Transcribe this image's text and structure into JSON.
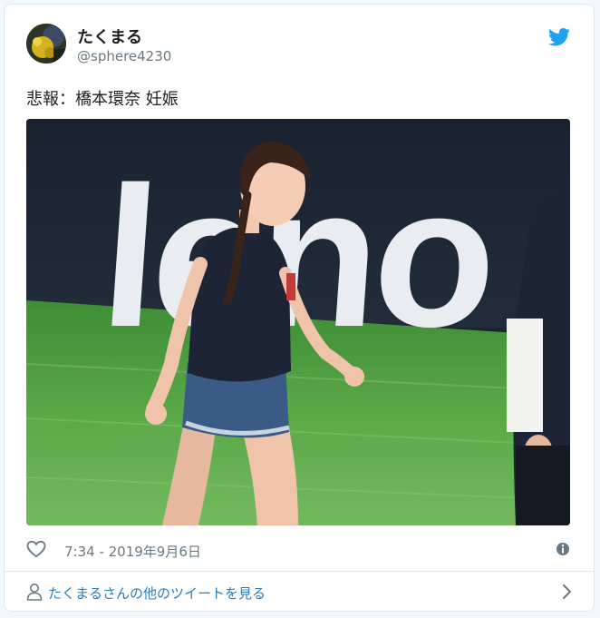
{
  "tweet": {
    "display_name": "たくまる",
    "handle": "@sphere4230",
    "text": "悲報：橋本環奈 妊娠",
    "timestamp": "7:34 - 2019年9月6日",
    "photo_banner_text": "leno"
  },
  "footer": {
    "more_tweets_label": "たくまるさんの他のツイートを見る"
  },
  "icons": {
    "brand": "twitter-bird-icon",
    "like": "heart-icon",
    "info": "info-icon",
    "user": "user-icon",
    "chevron": "chevron-right-icon"
  },
  "colors": {
    "twitter_blue": "#1da1f2",
    "link_blue": "#2b7bb9",
    "secondary_text": "#697882",
    "border": "#e1e8ed"
  }
}
